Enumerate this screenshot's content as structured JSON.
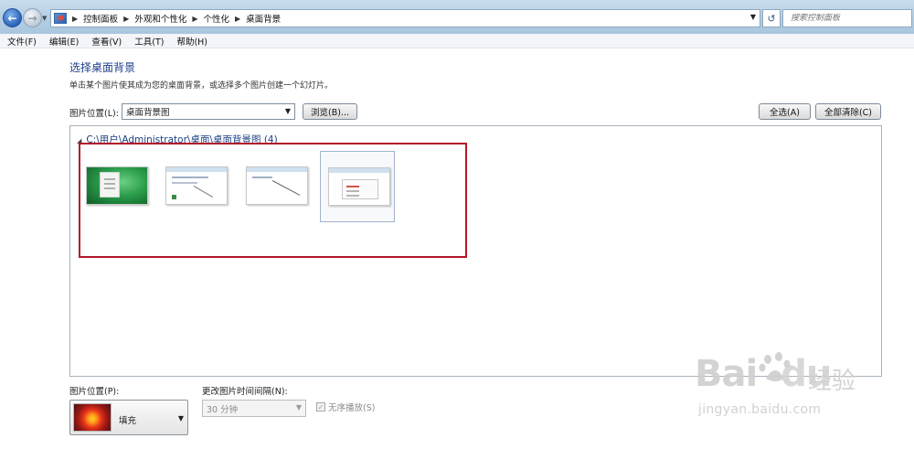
{
  "address_bar": {
    "breadcrumbs": [
      "控制面板",
      "外观和个性化",
      "个性化",
      "桌面背景"
    ],
    "search_placeholder": "搜索控制面板"
  },
  "menu": [
    "文件(F)",
    "编辑(E)",
    "查看(V)",
    "工具(T)",
    "帮助(H)"
  ],
  "page": {
    "title": "选择桌面背景",
    "description": "单击某个图片使其成为您的桌面背景，或选择多个图片创建一个幻灯片。"
  },
  "location": {
    "label": "图片位置(L):",
    "selected": "桌面背景图",
    "browse_label": "浏览(B)..."
  },
  "actions": {
    "select_all_label": "全选(A)",
    "clear_all_label": "全部清除(C)"
  },
  "image_group": {
    "header": "C:\\用户\\Administrator\\桌面\\桌面背景图 (4)",
    "thumbnails": [
      {
        "style": "green-desktop",
        "selected": false
      },
      {
        "style": "screenshot",
        "selected": false
      },
      {
        "style": "screenshot-line",
        "selected": false
      },
      {
        "style": "screenshot-dialog",
        "selected": true
      }
    ]
  },
  "picture_position": {
    "label": "图片位置(P):",
    "value": "填充"
  },
  "interval": {
    "label": "更改图片时间间隔(N):",
    "value": "30 分钟",
    "enabled": false
  },
  "shuffle": {
    "label": "无序播放(S)",
    "checked": true,
    "enabled": false
  },
  "watermark": {
    "logo_bai": "Bai",
    "logo_du": "du",
    "brand": "经验",
    "url": "jingyan.baidu.com"
  },
  "colors": {
    "highlight_border": "#b2162b",
    "title_blue": "#1e3f8a"
  }
}
